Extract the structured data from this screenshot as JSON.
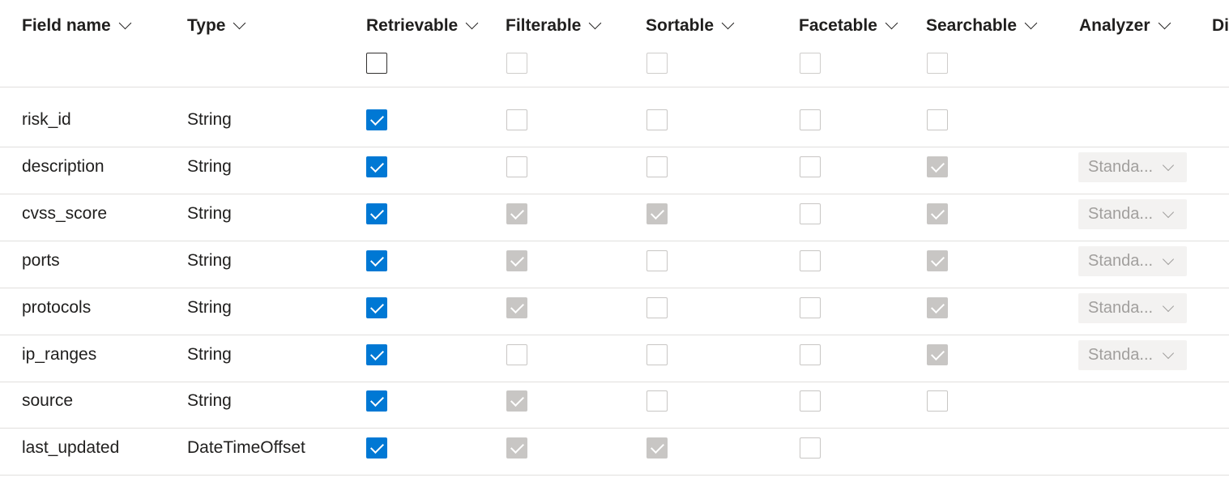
{
  "headers": {
    "field_name": "Field name",
    "type": "Type",
    "retrievable": "Retrievable",
    "filterable": "Filterable",
    "sortable": "Sortable",
    "facetable": "Facetable",
    "searchable": "Searchable",
    "analyzer": "Analyzer",
    "truncated": "Di"
  },
  "rows": [
    {
      "name": "risk_id",
      "type": "String",
      "retrievable": "checked",
      "filterable": "unchecked",
      "sortable": "unchecked",
      "facetable": "unchecked",
      "searchable": "unchecked",
      "analyzer": ""
    },
    {
      "name": "description",
      "type": "String",
      "retrievable": "checked",
      "filterable": "unchecked",
      "sortable": "unchecked",
      "facetable": "unchecked",
      "searchable": "disabled-checked",
      "analyzer": "Standa..."
    },
    {
      "name": "cvss_score",
      "type": "String",
      "retrievable": "checked",
      "filterable": "disabled-checked",
      "sortable": "disabled-checked",
      "facetable": "unchecked",
      "searchable": "disabled-checked",
      "analyzer": "Standa..."
    },
    {
      "name": "ports",
      "type": "String",
      "retrievable": "checked",
      "filterable": "disabled-checked",
      "sortable": "unchecked",
      "facetable": "unchecked",
      "searchable": "disabled-checked",
      "analyzer": "Standa..."
    },
    {
      "name": "protocols",
      "type": "String",
      "retrievable": "checked",
      "filterable": "disabled-checked",
      "sortable": "unchecked",
      "facetable": "unchecked",
      "searchable": "disabled-checked",
      "analyzer": "Standa..."
    },
    {
      "name": "ip_ranges",
      "type": "String",
      "retrievable": "checked",
      "filterable": "unchecked",
      "sortable": "unchecked",
      "facetable": "unchecked",
      "searchable": "disabled-checked",
      "analyzer": "Standa..."
    },
    {
      "name": "source",
      "type": "String",
      "retrievable": "checked",
      "filterable": "disabled-checked",
      "sortable": "unchecked",
      "facetable": "unchecked",
      "searchable": "unchecked",
      "analyzer": ""
    },
    {
      "name": "last_updated",
      "type": "DateTimeOffset",
      "retrievable": "checked",
      "filterable": "disabled-checked",
      "sortable": "disabled-checked",
      "facetable": "unchecked",
      "searchable": "none",
      "analyzer": ""
    }
  ],
  "colors": {
    "accent": "#0078d4",
    "disabled_fill": "#c8c6c4",
    "border": "#c8c6c4",
    "separator": "#e1dfdd",
    "dropdown_bg": "#f3f2f1",
    "dropdown_text": "#a19f9d"
  },
  "icons": {
    "column_sort": "chevron-down-icon",
    "checkmark": "checkmark-icon",
    "dropdown": "chevron-down-icon"
  }
}
